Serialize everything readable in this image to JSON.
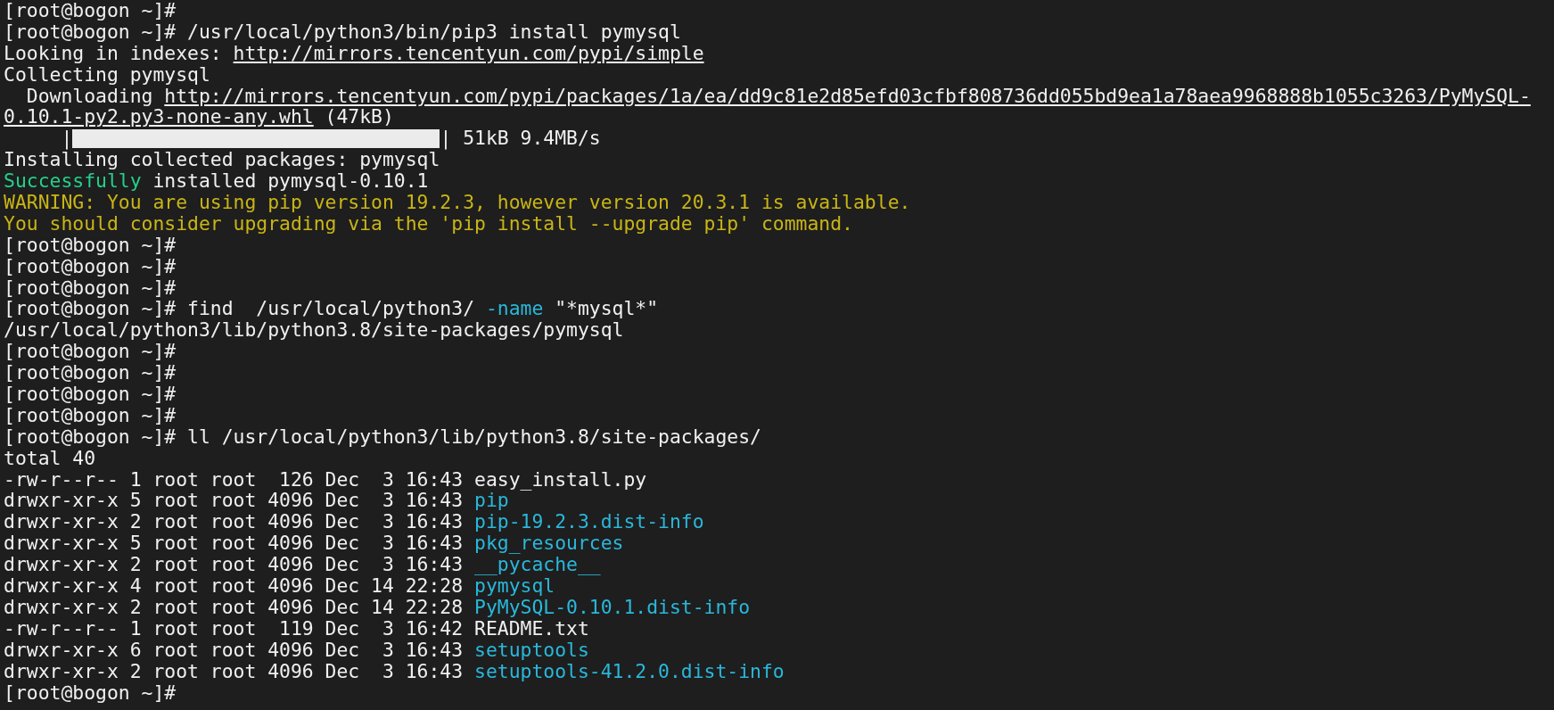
{
  "terminal": {
    "lines": [
      {
        "kind": "text",
        "parts": [
          {
            "text": "[root@bogon ~]#",
            "kind": "plain"
          }
        ]
      },
      {
        "kind": "text",
        "parts": [
          {
            "text": "[root@bogon ~]# /usr/local/python3/bin/pip3 install pymysql",
            "kind": "plain"
          }
        ]
      },
      {
        "kind": "text",
        "parts": [
          {
            "text": "Looking in indexes: ",
            "kind": "plain"
          },
          {
            "text": "http://mirrors.tencentyun.com/pypi/simple",
            "kind": "link"
          }
        ]
      },
      {
        "kind": "text",
        "parts": [
          {
            "text": "Collecting pymysql",
            "kind": "plain"
          }
        ]
      },
      {
        "kind": "text",
        "parts": [
          {
            "text": "  Downloading ",
            "kind": "plain"
          },
          {
            "text": "http://mirrors.tencentyun.com/pypi/packages/1a/ea/dd9c81e2d85efd03cfbf808736dd055bd9ea1a78aea9968888b1055c3263/PyMySQL-",
            "kind": "link"
          }
        ]
      },
      {
        "kind": "text",
        "parts": [
          {
            "text": "0.10.1-py2.py3-none-any.whl",
            "kind": "link"
          },
          {
            "text": " (47kB)",
            "kind": "plain"
          }
        ]
      },
      {
        "kind": "progress",
        "prefix": "     |",
        "level": 1,
        "suffix": "| 51kB 9.4MB/s"
      },
      {
        "kind": "text",
        "parts": [
          {
            "text": "Installing collected packages: pymysql",
            "kind": "plain"
          }
        ]
      },
      {
        "kind": "text",
        "parts": [
          {
            "text": "Successfully",
            "kind": "success"
          },
          {
            "text": " installed pymysql-0.10.1",
            "kind": "plain"
          }
        ]
      },
      {
        "kind": "text",
        "parts": [
          {
            "text": "WARNING: You are using pip version 19.2.3, however version 20.3.1 is available.",
            "kind": "warning"
          }
        ]
      },
      {
        "kind": "text",
        "parts": [
          {
            "text": "You should consider upgrading via the 'pip install --upgrade pip' command.",
            "kind": "warning"
          }
        ]
      },
      {
        "kind": "text",
        "parts": [
          {
            "text": "[root@bogon ~]#",
            "kind": "plain"
          }
        ]
      },
      {
        "kind": "text",
        "parts": [
          {
            "text": "[root@bogon ~]#",
            "kind": "plain"
          }
        ]
      },
      {
        "kind": "text",
        "parts": [
          {
            "text": "[root@bogon ~]#",
            "kind": "plain"
          }
        ]
      },
      {
        "kind": "text",
        "parts": [
          {
            "text": "[root@bogon ~]# find  /usr/local/python3/ ",
            "kind": "plain"
          },
          {
            "text": "-name",
            "kind": "highlight"
          },
          {
            "text": " \"*mysql*\"",
            "kind": "plain"
          }
        ]
      },
      {
        "kind": "text",
        "parts": [
          {
            "text": "/usr/local/python3/lib/python3.8/site-packages/pymysql",
            "kind": "plain"
          }
        ]
      },
      {
        "kind": "text",
        "parts": [
          {
            "text": "[root@bogon ~]#",
            "kind": "plain"
          }
        ]
      },
      {
        "kind": "text",
        "parts": [
          {
            "text": "[root@bogon ~]#",
            "kind": "plain"
          }
        ]
      },
      {
        "kind": "text",
        "parts": [
          {
            "text": "[root@bogon ~]#",
            "kind": "plain"
          }
        ]
      },
      {
        "kind": "text",
        "parts": [
          {
            "text": "[root@bogon ~]#",
            "kind": "plain"
          }
        ]
      },
      {
        "kind": "text",
        "parts": [
          {
            "text": "[root@bogon ~]# ll /usr/local/python3/lib/python3.8/site-packages/",
            "kind": "plain"
          }
        ]
      },
      {
        "kind": "text",
        "parts": [
          {
            "text": "total 40",
            "kind": "plain"
          }
        ]
      },
      {
        "kind": "text",
        "parts": [
          {
            "text": "-rw-r--r-- 1 root root  126 Dec  3 16:43 easy_install.py",
            "kind": "plain"
          }
        ]
      },
      {
        "kind": "text",
        "parts": [
          {
            "text": "drwxr-xr-x 5 root root 4096 Dec  3 16:43 ",
            "kind": "plain"
          },
          {
            "text": "pip",
            "kind": "highlight"
          }
        ]
      },
      {
        "kind": "text",
        "parts": [
          {
            "text": "drwxr-xr-x 2 root root 4096 Dec  3 16:43 ",
            "kind": "plain"
          },
          {
            "text": "pip-19.2.3.dist-info",
            "kind": "highlight"
          }
        ]
      },
      {
        "kind": "text",
        "parts": [
          {
            "text": "drwxr-xr-x 5 root root 4096 Dec  3 16:43 ",
            "kind": "plain"
          },
          {
            "text": "pkg_resources",
            "kind": "highlight"
          }
        ]
      },
      {
        "kind": "text",
        "parts": [
          {
            "text": "drwxr-xr-x 2 root root 4096 Dec  3 16:43 ",
            "kind": "plain"
          },
          {
            "text": "__pycache__",
            "kind": "highlight"
          }
        ]
      },
      {
        "kind": "text",
        "parts": [
          {
            "text": "drwxr-xr-x 4 root root 4096 Dec 14 22:28 ",
            "kind": "plain"
          },
          {
            "text": "pymysql",
            "kind": "highlight"
          }
        ]
      },
      {
        "kind": "text",
        "parts": [
          {
            "text": "drwxr-xr-x 2 root root 4096 Dec 14 22:28 ",
            "kind": "plain"
          },
          {
            "text": "PyMySQL-0.10.1.dist-info",
            "kind": "highlight"
          }
        ]
      },
      {
        "kind": "text",
        "parts": [
          {
            "text": "-rw-r--r-- 1 root root  119 Dec  3 16:42 README.txt",
            "kind": "plain"
          }
        ]
      },
      {
        "kind": "text",
        "parts": [
          {
            "text": "drwxr-xr-x 6 root root 4096 Dec  3 16:43 ",
            "kind": "plain"
          },
          {
            "text": "setuptools",
            "kind": "highlight"
          }
        ]
      },
      {
        "kind": "text",
        "parts": [
          {
            "text": "drwxr-xr-x 2 root root 4096 Dec  3 16:43 ",
            "kind": "plain"
          },
          {
            "text": "setuptools-41.2.0.dist-info",
            "kind": "highlight"
          }
        ]
      },
      {
        "kind": "text",
        "parts": [
          {
            "text": "[root@bogon ~]#",
            "kind": "plain"
          }
        ]
      }
    ]
  }
}
